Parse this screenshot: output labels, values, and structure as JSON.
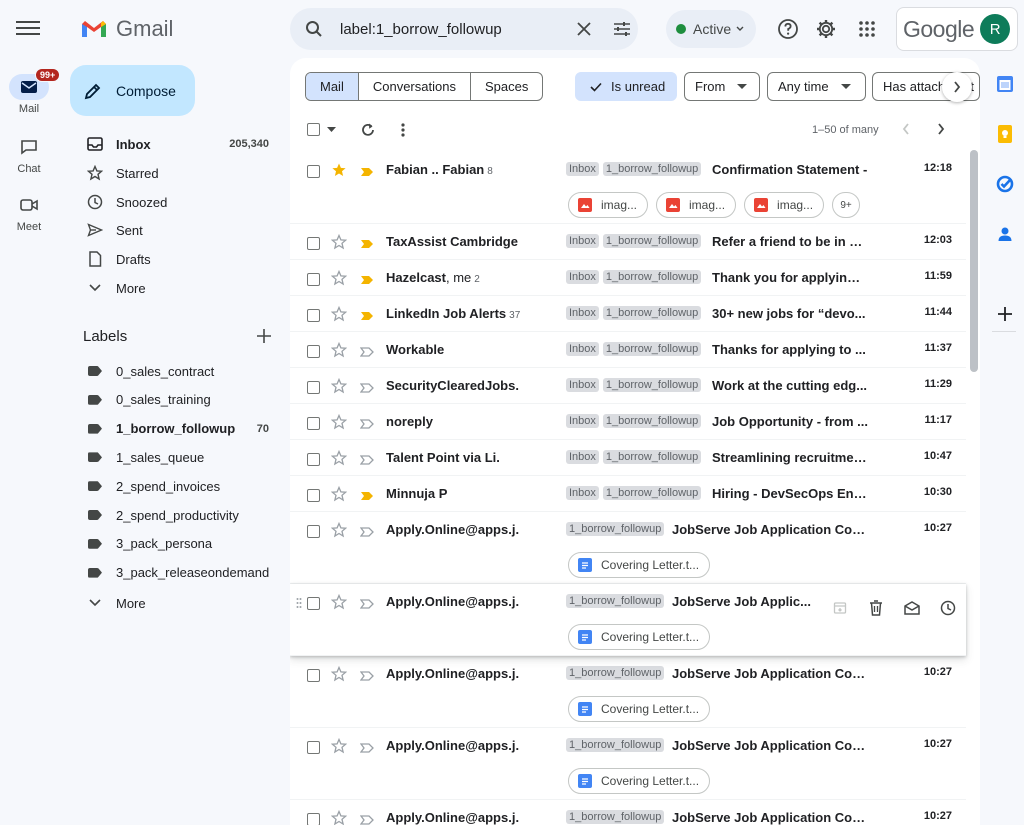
{
  "app": {
    "brand": "Gmail",
    "google": "Google",
    "avatar_letter": "R"
  },
  "rail": {
    "mail_label": "Mail",
    "mail_badge": "99+",
    "chat_label": "Chat",
    "meet_label": "Meet"
  },
  "search": {
    "value": "label:1_borrow_followup"
  },
  "status": {
    "label": "Active"
  },
  "compose_label": "Compose",
  "nav": [
    {
      "label": "Inbox",
      "count": "205,340",
      "icon": "inbox-icon",
      "bold": true
    },
    {
      "label": "Starred",
      "count": "",
      "icon": "star-icon"
    },
    {
      "label": "Snoozed",
      "count": "",
      "icon": "clock-icon"
    },
    {
      "label": "Sent",
      "count": "",
      "icon": "send-icon"
    },
    {
      "label": "Drafts",
      "count": "",
      "icon": "draft-icon"
    },
    {
      "label": "More",
      "count": "",
      "icon": "chevron-down-icon"
    }
  ],
  "labels_heading": "Labels",
  "labels": [
    {
      "label": "0_sales_contract",
      "count": ""
    },
    {
      "label": "0_sales_training",
      "count": ""
    },
    {
      "label": "1_borrow_followup",
      "count": "70",
      "bold": true
    },
    {
      "label": "1_sales_queue",
      "count": ""
    },
    {
      "label": "2_spend_invoices",
      "count": ""
    },
    {
      "label": "2_spend_productivity",
      "count": ""
    },
    {
      "label": "3_pack_persona",
      "count": ""
    },
    {
      "label": "3_pack_releaseondemand",
      "count": ""
    }
  ],
  "labels_more": "More",
  "segments": [
    "Mail",
    "Conversations",
    "Spaces"
  ],
  "filters": {
    "unread": "Is unread",
    "from": "From",
    "time": "Any time",
    "attach": "Has attachment"
  },
  "pagination": "1–50 of many",
  "rows": [
    {
      "sender": "Fabian .. Fabian",
      "me": "",
      "count": "8",
      "starred": true,
      "important": true,
      "tags": [
        "Inbox",
        "1_borrow_followup"
      ],
      "subject": "Confirmation Statement -",
      "time": "12:18",
      "attachments": [
        "imag...",
        "imag...",
        "imag..."
      ],
      "more": "9+"
    },
    {
      "sender": "TaxAssist Cambridge",
      "me": "",
      "count": "",
      "important": true,
      "tags": [
        "Inbox",
        "1_borrow_followup"
      ],
      "subject": "Refer a friend to be in w...",
      "time": "12:03"
    },
    {
      "sender": "Hazelcast",
      "me": ", me",
      "count": "2",
      "important": true,
      "tags": [
        "Inbox",
        "1_borrow_followup"
      ],
      "subject": "Thank you for applying ...",
      "time": "11:59"
    },
    {
      "sender": "LinkedIn Job Alerts",
      "me": "",
      "count": "37",
      "important": true,
      "tags": [
        "Inbox",
        "1_borrow_followup"
      ],
      "subject": "30+ new jobs for “devo...",
      "time": "11:44"
    },
    {
      "sender": "Workable",
      "me": "",
      "count": "",
      "important": false,
      "tags": [
        "Inbox",
        "1_borrow_followup"
      ],
      "subject": "Thanks for applying to ...",
      "time": "11:37"
    },
    {
      "sender": "SecurityClearedJobs.",
      "me": "",
      "count": "",
      "important": false,
      "tags": [
        "Inbox",
        "1_borrow_followup"
      ],
      "subject": "Work at the cutting edg...",
      "time": "11:29"
    },
    {
      "sender": "noreply",
      "me": "",
      "count": "",
      "important": false,
      "tags": [
        "Inbox",
        "1_borrow_followup"
      ],
      "subject": "Job Opportunity - from ...",
      "time": "11:17"
    },
    {
      "sender": "Talent Point via Li.",
      "me": "",
      "count": "",
      "important": false,
      "tags": [
        "Inbox",
        "1_borrow_followup"
      ],
      "subject": "Streamlining recruitmen...",
      "time": "10:47"
    },
    {
      "sender": "Minnuja P",
      "me": "",
      "count": "",
      "important": true,
      "tags": [
        "Inbox",
        "1_borrow_followup"
      ],
      "subject": "Hiring - DevSecOps Eng...",
      "time": "10:30"
    },
    {
      "sender": "Apply.Online@apps.j.",
      "me": "",
      "count": "",
      "important": false,
      "tags": [
        "1_borrow_followup"
      ],
      "subject": "JobServe Job Application Con...",
      "time": "10:27",
      "attachments": [
        "Covering Letter.t..."
      ]
    },
    {
      "sender": "Apply.Online@apps.j.",
      "me": "",
      "count": "",
      "important": false,
      "tags": [
        "1_borrow_followup"
      ],
      "subject": "JobServe Job Applic...",
      "time": "",
      "attachments": [
        "Covering Letter.t..."
      ],
      "hover": true
    },
    {
      "sender": "Apply.Online@apps.j.",
      "me": "",
      "count": "",
      "important": false,
      "tags": [
        "1_borrow_followup"
      ],
      "subject": "JobServe Job Application Con...",
      "time": "10:27",
      "attachments": [
        "Covering Letter.t..."
      ]
    },
    {
      "sender": "Apply.Online@apps.j.",
      "me": "",
      "count": "",
      "important": false,
      "tags": [
        "1_borrow_followup"
      ],
      "subject": "JobServe Job Application Con...",
      "time": "10:27",
      "attachments": [
        "Covering Letter.t..."
      ]
    },
    {
      "sender": "Apply.Online@apps.j.",
      "me": "",
      "count": "",
      "important": false,
      "tags": [
        "1_borrow_followup"
      ],
      "subject": "JobServe Job Application Con...",
      "time": "10:27"
    }
  ]
}
